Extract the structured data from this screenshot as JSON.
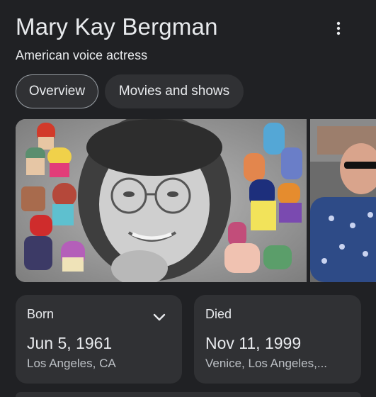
{
  "header": {
    "title": "Mary Kay Bergman",
    "subtitle": "American voice actress",
    "more_icon": "more-vert-icon"
  },
  "tabs": [
    {
      "label": "Overview",
      "active": true
    },
    {
      "label": "Movies and shows",
      "active": false
    }
  ],
  "gallery": {
    "images": [
      {
        "name": "portrait-collage-image"
      },
      {
        "name": "second-photo-image"
      }
    ]
  },
  "facts": {
    "born": {
      "label": "Born",
      "date": "Jun 5, 1961",
      "place": "Los Angeles, CA",
      "icon": "chevron-down-icon"
    },
    "died": {
      "label": "Died",
      "date": "Nov 11, 1999",
      "place": "Venice, Los Angeles,..."
    }
  },
  "colors": {
    "background": "#202124",
    "surface": "#303134",
    "text_primary": "#e8eaed",
    "text_secondary": "#bdc1c6",
    "tab_border": "#9aa0a6"
  }
}
